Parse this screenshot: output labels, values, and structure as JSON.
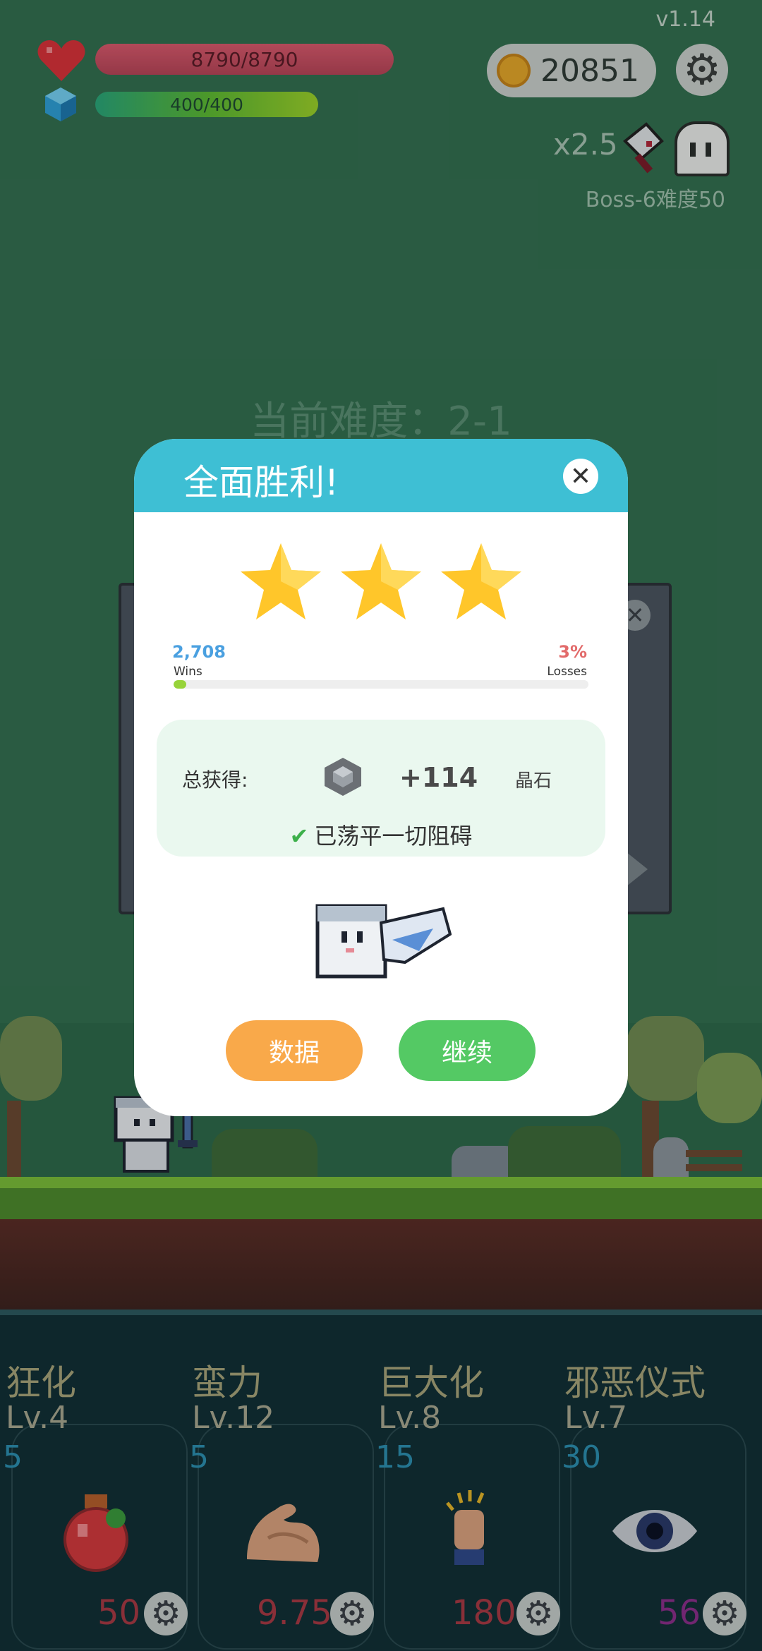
{
  "hud": {
    "version": "v1.14",
    "hp_text": "8790/8790",
    "mp_text": "400/400",
    "coins": "20851",
    "multiplier": "x2.5",
    "boss_text": "Boss-6难度50"
  },
  "stage": {
    "difficulty_text": "当前难度：2-1"
  },
  "modal": {
    "title": "全面胜利!",
    "stars": 3,
    "wins_value": "2,708",
    "wins_label": "Wins",
    "losses_value": "3%",
    "losses_label": "Losses",
    "win_progress": 0.03,
    "reward_label": "总获得:",
    "reward_amount": "+114",
    "reward_unit": "晶石",
    "reward_note": "已荡平一切阻碍",
    "btn_data": "数据",
    "btn_continue": "继续"
  },
  "skills": [
    {
      "name": "狂化",
      "level": "Lv.4",
      "count": "5",
      "cost": "50",
      "icon": "potion-icon",
      "cost_color": "#a83a45"
    },
    {
      "name": "蛮力",
      "level": "Lv.12",
      "count": "5",
      "cost": "9.75",
      "icon": "muscle-arm-icon",
      "cost_color": "#a83a45"
    },
    {
      "name": "巨大化",
      "level": "Lv.8",
      "count": "15",
      "cost": "180",
      "icon": "hand-icon",
      "cost_color": "#a83a45"
    },
    {
      "name": "邪恶仪式",
      "level": "Lv.7",
      "count": "30",
      "cost": "56",
      "icon": "eye-icon",
      "cost_color": "#8a2f8a"
    }
  ],
  "colors": {
    "modal_header": "#3ebfd4",
    "btn_data": "#f9a94a",
    "btn_continue": "#54c964",
    "star": "#ffc62a"
  }
}
